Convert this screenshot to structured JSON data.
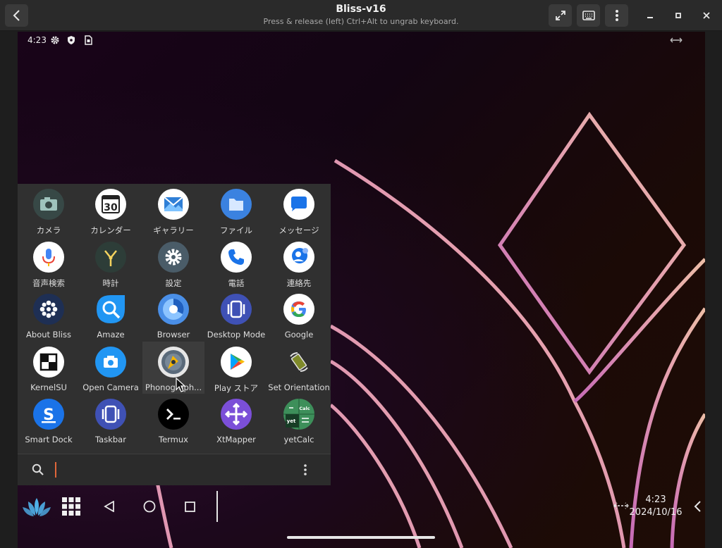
{
  "window": {
    "title": "Bliss-v16",
    "subtitle": "Press & release (left) Ctrl+Alt to ungrab keyboard."
  },
  "statusbar": {
    "time": "4:23",
    "icons": [
      "gear-icon",
      "shield-icon",
      "sim-card-icon"
    ],
    "right_icon": "desktop-mode-arrows-icon"
  },
  "drawer": {
    "apps": [
      {
        "label": "カメラ",
        "icon": "camera-icon"
      },
      {
        "label": "カレンダー",
        "icon": "calendar-icon",
        "day": "30"
      },
      {
        "label": "ギャラリー",
        "icon": "gallery-icon"
      },
      {
        "label": "ファイル",
        "icon": "files-icon"
      },
      {
        "label": "メッセージ",
        "icon": "messages-icon"
      },
      {
        "label": "音声検索",
        "icon": "microphone-icon"
      },
      {
        "label": "時計",
        "icon": "clock-icon"
      },
      {
        "label": "設定",
        "icon": "settings-icon"
      },
      {
        "label": "電話",
        "icon": "phone-icon"
      },
      {
        "label": "連絡先",
        "icon": "contacts-icon"
      },
      {
        "label": "About Bliss",
        "icon": "about-bliss-icon"
      },
      {
        "label": "Amaze",
        "icon": "amaze-icon"
      },
      {
        "label": "Browser",
        "icon": "browser-icon"
      },
      {
        "label": "Desktop Mode",
        "icon": "desktop-mode-icon"
      },
      {
        "label": "Google",
        "icon": "google-icon"
      },
      {
        "label": "KernelSU",
        "icon": "kernelsu-icon"
      },
      {
        "label": "Open Camera",
        "icon": "open-camera-icon"
      },
      {
        "label": "Phonograph...",
        "icon": "phonograph-icon"
      },
      {
        "label": "Play ストア",
        "icon": "play-store-icon"
      },
      {
        "label": "Set Orientation",
        "icon": "set-orientation-icon"
      },
      {
        "label": "Smart Dock",
        "icon": "smart-dock-icon"
      },
      {
        "label": "Taskbar",
        "icon": "taskbar-icon"
      },
      {
        "label": "Termux",
        "icon": "termux-icon"
      },
      {
        "label": "XtMapper",
        "icon": "xtmapper-icon"
      },
      {
        "label": "yetCalc",
        "icon": "yetcalc-icon",
        "badge_top": "Calc",
        "badge_bottom": "yet"
      }
    ],
    "search": {
      "value": "",
      "placeholder": ""
    }
  },
  "taskbar": {
    "clock_time": "4:23",
    "clock_date": "2024/10/16"
  }
}
